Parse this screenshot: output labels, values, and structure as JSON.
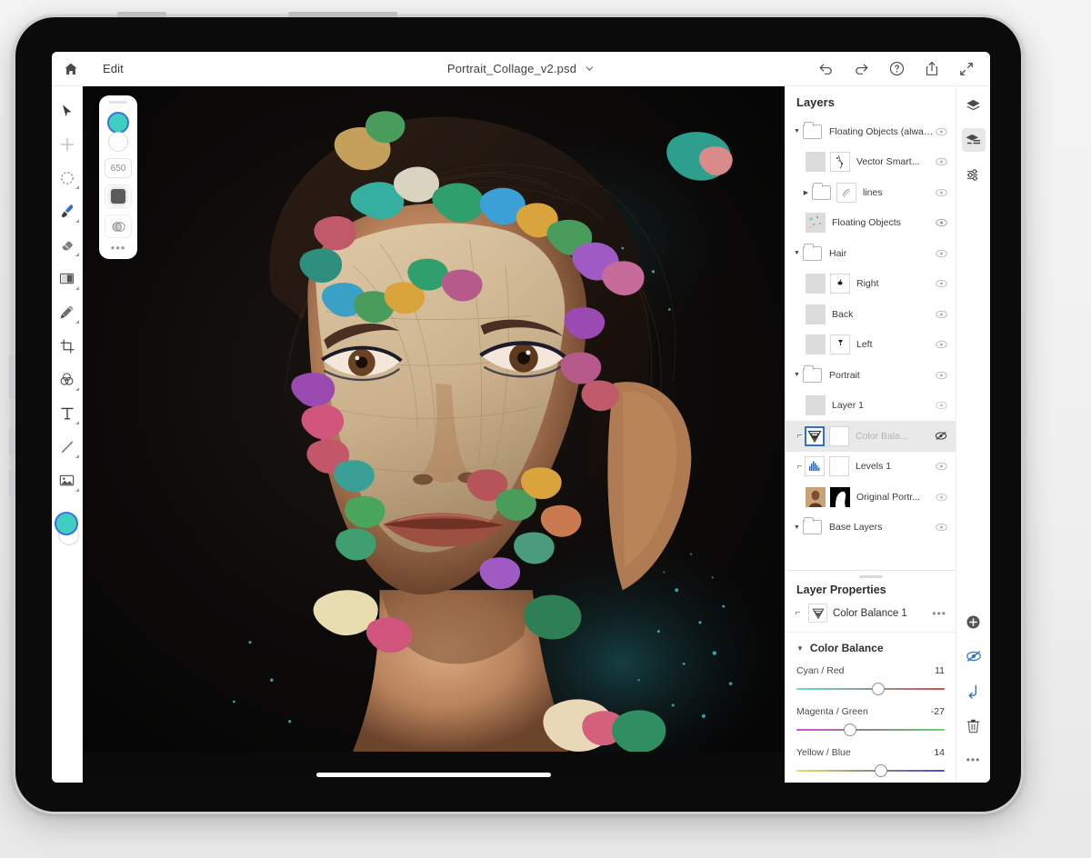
{
  "app": {
    "topbar": {
      "home_icon": "home-icon",
      "edit_label": "Edit",
      "filename": "Portrait_Collage_v2.psd",
      "filename_chevron": "chevron-down-icon",
      "actions": [
        {
          "name": "undo-icon",
          "label": "Undo"
        },
        {
          "name": "redo-icon",
          "label": "Redo"
        },
        {
          "name": "help-icon",
          "label": "Help"
        },
        {
          "name": "share-icon",
          "label": "Share"
        },
        {
          "name": "expand-icon",
          "label": "Expand"
        }
      ]
    },
    "tools": [
      {
        "name": "select-tool",
        "label": "Select",
        "sub": false,
        "active": false
      },
      {
        "name": "transform-tool",
        "label": "Transform",
        "sub": false,
        "active": false
      },
      {
        "name": "lasso-tool",
        "label": "Lasso Select",
        "sub": true,
        "active": false
      },
      {
        "name": "brush-tool",
        "label": "Brush",
        "sub": true,
        "active": true
      },
      {
        "name": "eraser-tool",
        "label": "Eraser",
        "sub": true,
        "active": false
      },
      {
        "name": "gradient-tool",
        "label": "Gradient",
        "sub": true,
        "active": false
      },
      {
        "name": "clone-stamp-tool",
        "label": "Clone Stamp",
        "sub": true,
        "active": false
      },
      {
        "name": "crop-tool",
        "label": "Crop",
        "sub": false,
        "active": false
      },
      {
        "name": "adjustment-tool",
        "label": "Adjustments",
        "sub": true,
        "active": false
      },
      {
        "name": "text-tool",
        "label": "Type",
        "sub": true,
        "active": false
      },
      {
        "name": "line-tool",
        "label": "Line",
        "sub": true,
        "active": false
      },
      {
        "name": "place-photo-tool",
        "label": "Place Photo",
        "sub": true,
        "active": false
      }
    ],
    "brush_panel": {
      "size": "650",
      "foreground_color": "#3ecfc0",
      "background_color": "#ffffff",
      "more_label": "•••"
    },
    "panel": {
      "layers_title": "Layers",
      "layers": [
        {
          "name": "Floating Objects (alway...",
          "type": "group",
          "depth": 0,
          "expanded": true,
          "visible": true,
          "selected": false,
          "clipped": false
        },
        {
          "name": "Vector Smart...",
          "type": "layer",
          "depth": 1,
          "visible": true,
          "selected": false,
          "clipped": false,
          "has_mask": true
        },
        {
          "name": "lines",
          "type": "group",
          "depth": 1,
          "expanded": false,
          "visible": true,
          "selected": false,
          "clipped": false,
          "has_mask": true
        },
        {
          "name": "Floating Objects",
          "type": "layer",
          "depth": 1,
          "visible": true,
          "selected": false,
          "clipped": false
        },
        {
          "name": "Hair",
          "type": "group",
          "depth": 0,
          "expanded": true,
          "visible": true,
          "selected": false,
          "clipped": false
        },
        {
          "name": "Right",
          "type": "layer",
          "depth": 1,
          "visible": true,
          "selected": false,
          "clipped": false,
          "has_mask": true
        },
        {
          "name": "Back",
          "type": "layer",
          "depth": 1,
          "visible": true,
          "selected": false,
          "clipped": false
        },
        {
          "name": "Left",
          "type": "layer",
          "depth": 1,
          "visible": true,
          "selected": false,
          "clipped": false,
          "has_mask": true
        },
        {
          "name": "Portrait",
          "type": "group",
          "depth": 0,
          "expanded": true,
          "visible": true,
          "selected": false,
          "clipped": false
        },
        {
          "name": "Layer 1",
          "type": "layer",
          "depth": 1,
          "visible": true,
          "selected": false,
          "clipped": false
        },
        {
          "name": "Color Bala...",
          "type": "adjustment",
          "depth": 1,
          "visible": false,
          "selected": true,
          "clipped": true
        },
        {
          "name": "Levels 1",
          "type": "adjustment",
          "depth": 1,
          "visible": true,
          "selected": false,
          "clipped": true,
          "has_mask": true
        },
        {
          "name": "Original Portr...",
          "type": "layer",
          "depth": 1,
          "visible": true,
          "selected": false,
          "clipped": false,
          "has_mask": true
        },
        {
          "name": "Base Layers",
          "type": "group",
          "depth": 0,
          "expanded": true,
          "visible": true,
          "selected": false,
          "clipped": false
        }
      ],
      "layer_properties_title": "Layer Properties",
      "layer_properties_name": "Color Balance 1",
      "layer_properties_more": "•••",
      "color_balance": {
        "section_title": "Color Balance",
        "sliders": [
          {
            "label": "Cyan / Red",
            "value": "11",
            "numeric": 11,
            "min": -100,
            "max": 100,
            "from_color": "#6fd8dd",
            "to_color": "#d94b4b"
          },
          {
            "label": "Magenta / Green",
            "value": "-27",
            "numeric": -27,
            "min": -100,
            "max": 100,
            "from_color": "#d44fd4",
            "to_color": "#6ed36e"
          },
          {
            "label": "Yellow / Blue",
            "value": "14",
            "numeric": 14,
            "min": -100,
            "max": 100,
            "from_color": "#e3e36a",
            "to_color": "#4a4ad8"
          }
        ]
      }
    },
    "icon_rail": [
      {
        "name": "layers-stack-icon",
        "label": "Layers",
        "active": false
      },
      {
        "name": "layers-list-icon",
        "label": "Layer List",
        "active": true
      },
      {
        "name": "adjustments-icon",
        "label": "Adjustments",
        "active": false
      }
    ],
    "icon_rail_bottom": [
      {
        "name": "add-layer-icon",
        "label": "Add Layer",
        "accent": false
      },
      {
        "name": "hide-layer-icon",
        "label": "Hide Layer",
        "accent": true
      },
      {
        "name": "clip-layer-icon",
        "label": "Clip To Layer",
        "accent": true
      },
      {
        "name": "delete-layer-icon",
        "label": "Delete Layer",
        "accent": false
      },
      {
        "name": "more-options-icon",
        "label": "•••",
        "accent": false
      }
    ],
    "colors": {
      "accent_blue": "#2f6fd0",
      "selection_gray": "#e9e9e9",
      "canvas_black": "#0a0a0b"
    }
  }
}
